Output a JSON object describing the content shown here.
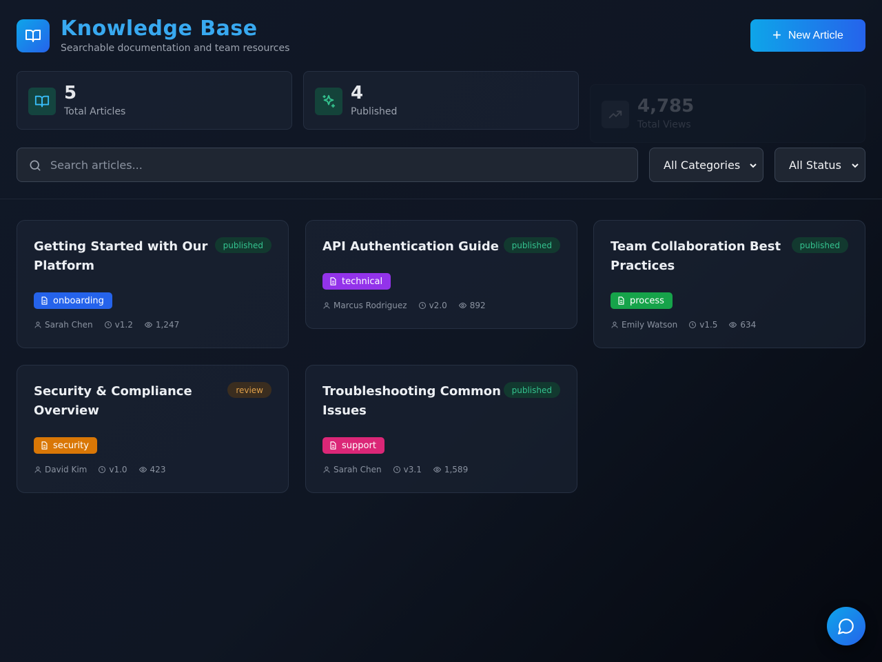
{
  "header": {
    "title": "Knowledge Base",
    "subtitle": "Searchable documentation and team resources",
    "new_button": "New Article"
  },
  "stats": [
    {
      "value": "5",
      "label": "Total Articles"
    },
    {
      "value": "4",
      "label": "Published"
    },
    {
      "value": "4,785",
      "label": "Total Views"
    }
  ],
  "filters": {
    "search_placeholder": "Search articles...",
    "category": "All Categories",
    "status": "All Status"
  },
  "articles": [
    {
      "title": "Getting Started with Our Platform",
      "status": "published",
      "tag": "onboarding",
      "tag_color": "#2563eb",
      "author": "Sarah Chen",
      "version": "v1.2",
      "views": "1,247"
    },
    {
      "title": "API Authentication Guide",
      "status": "published",
      "tag": "technical",
      "tag_color": "#9333ea",
      "author": "Marcus Rodriguez",
      "version": "v2.0",
      "views": "892"
    },
    {
      "title": "Team Collaboration Best Practices",
      "status": "published",
      "tag": "process",
      "tag_color": "#16a34a",
      "author": "Emily Watson",
      "version": "v1.5",
      "views": "634"
    },
    {
      "title": "Security & Compliance Overview",
      "status": "review",
      "tag": "security",
      "tag_color": "#d97706",
      "author": "David Kim",
      "version": "v1.0",
      "views": "423"
    },
    {
      "title": "Troubleshooting Common Issues",
      "status": "published",
      "tag": "support",
      "tag_color": "#db2777",
      "author": "Sarah Chen",
      "version": "v3.1",
      "views": "1,589"
    }
  ],
  "colors": {
    "accent": "#38a9f0",
    "published": "#34c38f",
    "review": "#e0a04a"
  },
  "icons": {
    "logo": "book-open-icon",
    "stat_articles": "book-open-icon",
    "stat_published": "sparkles-icon",
    "stat_views": "trending-up-icon",
    "search": "search-icon",
    "tag": "document-icon",
    "author": "user-icon",
    "version": "clock-icon",
    "views": "eye-icon",
    "fab": "chat-bubble-icon"
  }
}
